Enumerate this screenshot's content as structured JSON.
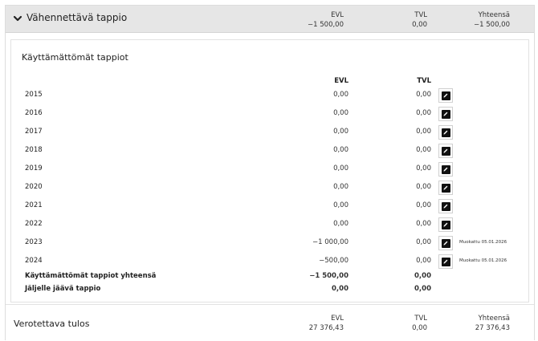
{
  "header": {
    "title": "Vähennettävä tappio",
    "evl_label": "EVL",
    "evl_value": "−1 500,00",
    "tvl_label": "TVL",
    "tvl_value": "0,00",
    "total_label": "Yhteensä",
    "total_value": "−1 500,00"
  },
  "card": {
    "title": "Käyttämättömät tappiot",
    "col_evl": "EVL",
    "col_tvl": "TVL",
    "rows": [
      {
        "year": "2015",
        "evl": "0,00",
        "tvl": "0,00",
        "modified": ""
      },
      {
        "year": "2016",
        "evl": "0,00",
        "tvl": "0,00",
        "modified": ""
      },
      {
        "year": "2017",
        "evl": "0,00",
        "tvl": "0,00",
        "modified": ""
      },
      {
        "year": "2018",
        "evl": "0,00",
        "tvl": "0,00",
        "modified": ""
      },
      {
        "year": "2019",
        "evl": "0,00",
        "tvl": "0,00",
        "modified": ""
      },
      {
        "year": "2020",
        "evl": "0,00",
        "tvl": "0,00",
        "modified": ""
      },
      {
        "year": "2021",
        "evl": "0,00",
        "tvl": "0,00",
        "modified": ""
      },
      {
        "year": "2022",
        "evl": "0,00",
        "tvl": "0,00",
        "modified": ""
      },
      {
        "year": "2023",
        "evl": "−1 000,00",
        "tvl": "0,00",
        "modified": "Muokattu 05.01.2026"
      },
      {
        "year": "2024",
        "evl": "−500,00",
        "tvl": "0,00",
        "modified": "Muokattu 05.01.2026"
      }
    ],
    "summary": [
      {
        "label": "Käyttämättömät tappiot yhteensä",
        "evl": "−1 500,00",
        "tvl": "0,00"
      },
      {
        "label": "Jäljelle jäävä tappio",
        "evl": "0,00",
        "tvl": "0,00"
      }
    ]
  },
  "footer": {
    "title": "Verotettava tulos",
    "evl_label": "EVL",
    "evl_value": "27 376,43",
    "tvl_label": "TVL",
    "tvl_value": "0,00",
    "total_label": "Yhteensä",
    "total_value": "27 376,43"
  },
  "icons": {
    "chevron": "chevron-down-icon",
    "edit": "pencil-icon"
  },
  "colors": {
    "header_bg": "#e6e6e6",
    "icon_dark": "#111111"
  }
}
